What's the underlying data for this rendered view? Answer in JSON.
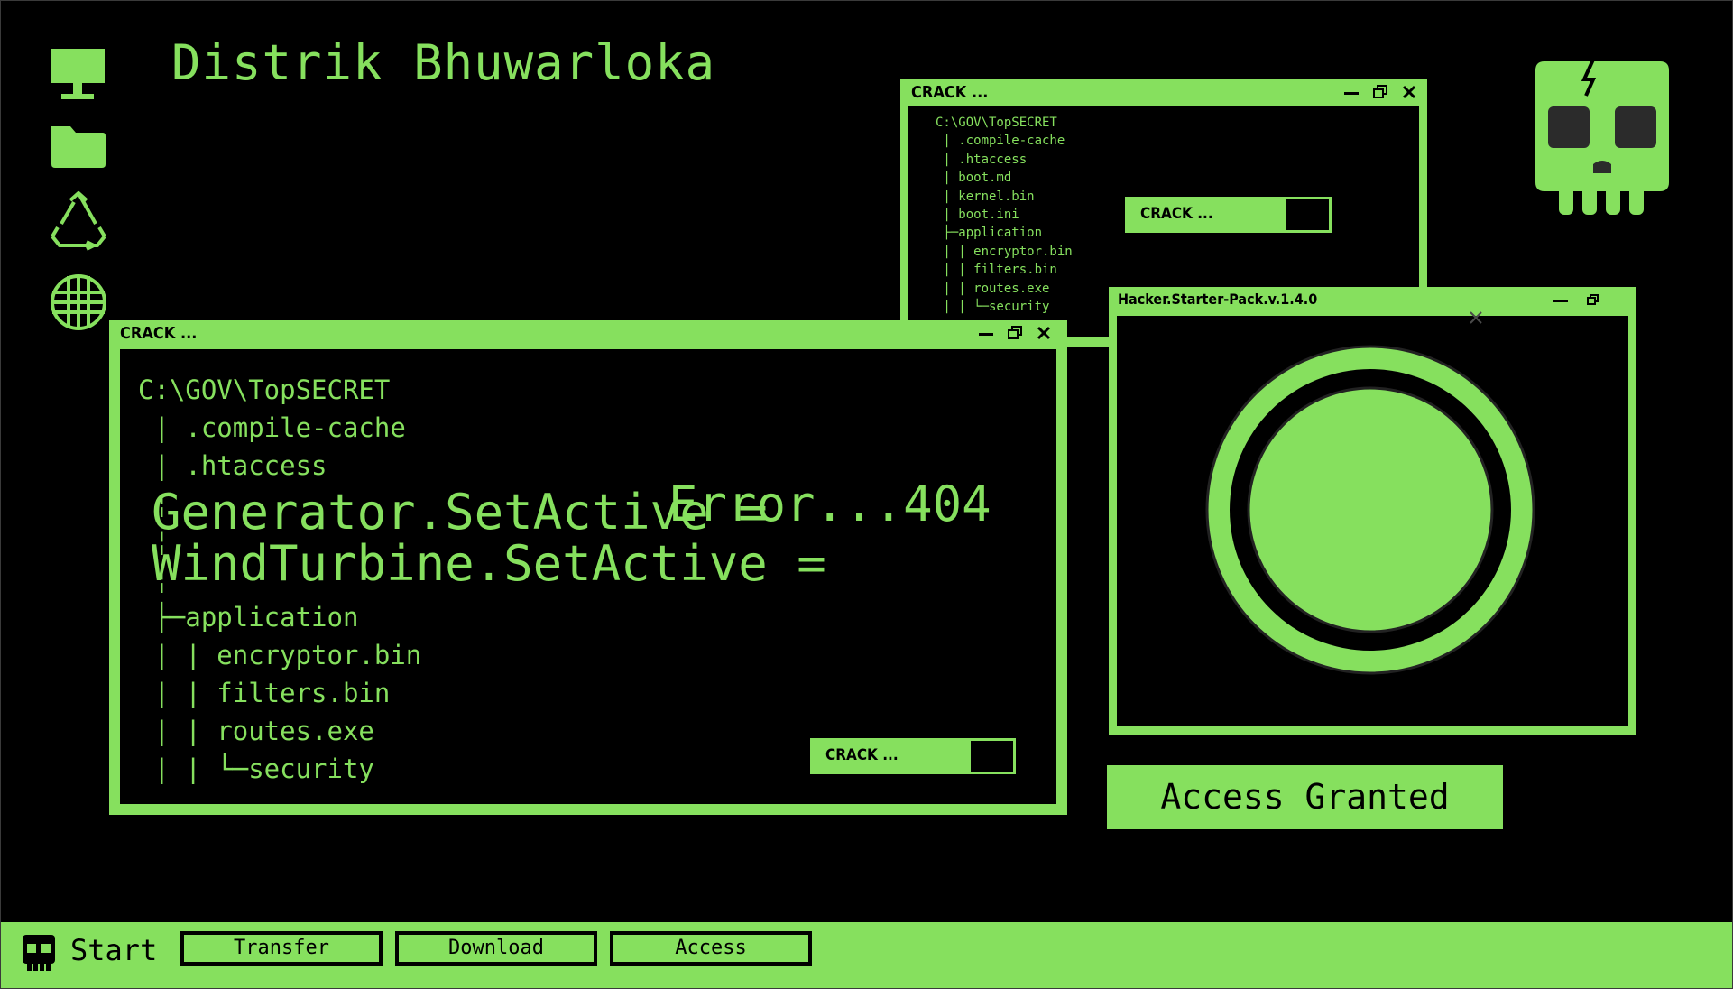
{
  "desktop": {
    "title": "Distrik Bhuwarloka",
    "icons": [
      "monitor-icon",
      "folder-icon",
      "recycle-icon",
      "globe-icon"
    ]
  },
  "colors": {
    "accent": "#86e05e",
    "background": "#000000"
  },
  "window_back": {
    "title": "CRACK ...",
    "tree": "C:\\GOV\\TopSECRET\n | .compile-cache\n | .htaccess\n | boot.md\n | kernel.bin\n | boot.ini\n ├─application\n | | encryptor.bin\n | | filters.bin\n | | routes.exe\n | | └─security",
    "progress_label": "CRACK ...",
    "progress": 0.79
  },
  "window_main": {
    "title": "CRACK ...",
    "tree_top": "C:\\GOV\\TopSECRET\n | .compile-cache\n | .htaccess\n ¦\n ¦\n ¦",
    "tree_bottom": " ├─application\n | | encryptor.bin\n | | filters.bin\n | | routes.exe\n | | └─security",
    "generator_line": "Generator.SetActive =",
    "generator_result": "Error...404",
    "windturbine_line": "WindTurbine.SetActive =",
    "progress_label": "CRACK ...",
    "progress": 0.79
  },
  "window_hacker": {
    "title": "Hacker.Starter-Pack.v.1.4.0"
  },
  "access_label": "Access Granted",
  "taskbar": {
    "start_label": "Start",
    "buttons": [
      "Transfer",
      "Download",
      "Access"
    ]
  }
}
